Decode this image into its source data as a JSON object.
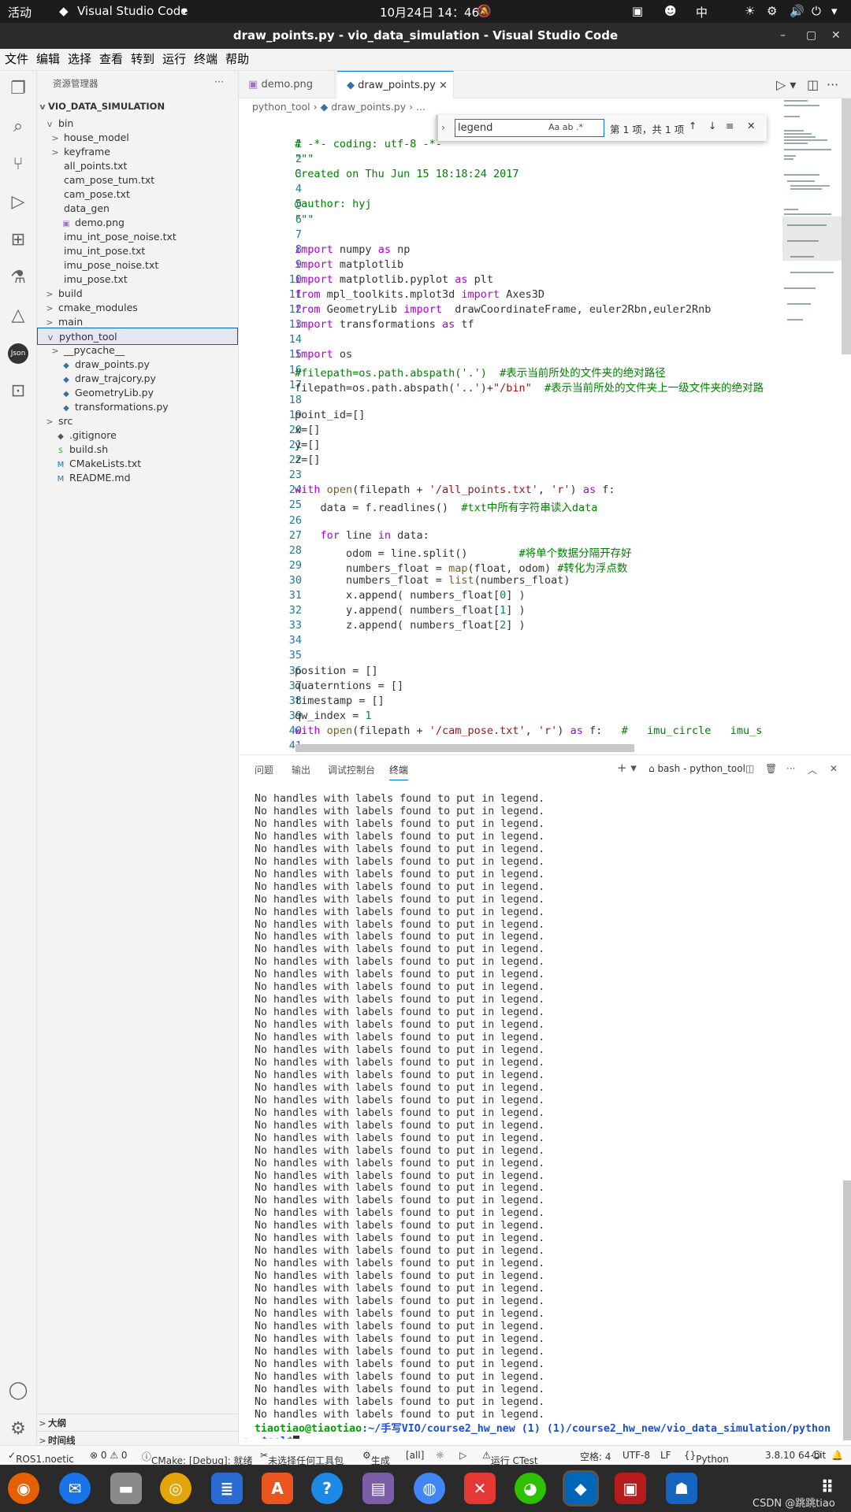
{
  "topbar": {
    "activities": "活动",
    "app": "Visual Studio Code",
    "datetime": "10月24日  14：46",
    "input": "中"
  },
  "window": {
    "title": "draw_points.py - vio_data_simulation - Visual Studio Code"
  },
  "menu": [
    "文件",
    "编辑",
    "选择",
    "查看",
    "转到",
    "运行",
    "终端",
    "帮助"
  ],
  "explorer": {
    "header": "资源管理器",
    "root": "VIO_DATA_SIMULATION",
    "items": [
      {
        "label": "bin",
        "depth": 1,
        "arrow": "v",
        "icon": ""
      },
      {
        "label": "house_model",
        "depth": 2,
        "arrow": ">",
        "icon": ""
      },
      {
        "label": "keyframe",
        "depth": 2,
        "arrow": ">",
        "icon": ""
      },
      {
        "label": "all_points.txt",
        "depth": 2,
        "arrow": "",
        "icon": ""
      },
      {
        "label": "cam_pose_tum.txt",
        "depth": 2,
        "arrow": "",
        "icon": ""
      },
      {
        "label": "cam_pose.txt",
        "depth": 2,
        "arrow": "",
        "icon": ""
      },
      {
        "label": "data_gen",
        "depth": 2,
        "arrow": "",
        "icon": ""
      },
      {
        "label": "demo.png",
        "depth": 2,
        "arrow": "",
        "icon": "img"
      },
      {
        "label": "imu_int_pose_noise.txt",
        "depth": 2,
        "arrow": "",
        "icon": ""
      },
      {
        "label": "imu_int_pose.txt",
        "depth": 2,
        "arrow": "",
        "icon": ""
      },
      {
        "label": "imu_pose_noise.txt",
        "depth": 2,
        "arrow": "",
        "icon": ""
      },
      {
        "label": "imu_pose.txt",
        "depth": 2,
        "arrow": "",
        "icon": ""
      },
      {
        "label": "build",
        "depth": 1,
        "arrow": ">",
        "icon": ""
      },
      {
        "label": "cmake_modules",
        "depth": 1,
        "arrow": ">",
        "icon": ""
      },
      {
        "label": "main",
        "depth": 1,
        "arrow": ">",
        "icon": ""
      },
      {
        "label": "python_tool",
        "depth": 1,
        "arrow": "v",
        "icon": ""
      },
      {
        "label": "__pycache__",
        "depth": 2,
        "arrow": ">",
        "icon": ""
      },
      {
        "label": "draw_points.py",
        "depth": 2,
        "arrow": "",
        "icon": "py"
      },
      {
        "label": "draw_trajcory.py",
        "depth": 2,
        "arrow": "",
        "icon": "py"
      },
      {
        "label": "GeometryLib.py",
        "depth": 2,
        "arrow": "",
        "icon": "py"
      },
      {
        "label": "transformations.py",
        "depth": 2,
        "arrow": "",
        "icon": "py"
      },
      {
        "label": "src",
        "depth": 1,
        "arrow": ">",
        "icon": ""
      },
      {
        "label": ".gitignore",
        "depth": 1,
        "arrow": "",
        "icon": "git"
      },
      {
        "label": "build.sh",
        "depth": 1,
        "arrow": "",
        "icon": "sh"
      },
      {
        "label": "CMakeLists.txt",
        "depth": 1,
        "arrow": "",
        "icon": "M"
      },
      {
        "label": "README.md",
        "depth": 1,
        "arrow": "",
        "icon": "md"
      }
    ],
    "outline": "大纲",
    "timeline": "时间线"
  },
  "tabs": [
    {
      "label": "demo.png"
    },
    {
      "label": "draw_points.py",
      "close": "×"
    }
  ],
  "breadcrumb": {
    "a": "python_tool",
    "b": "draw_points.py",
    "c": "..."
  },
  "find": {
    "query": "legend",
    "options": "Aa  ab  .*",
    "result": "第 1 项，共 1 项"
  },
  "code": [
    "# -*- coding: utf-8 -*-",
    "\"\"\"",
    "Created on Thu Jun 15 18:18:24 2017",
    "",
    "@author: hyj",
    "\"\"\"",
    "",
    "import numpy as np",
    "import matplotlib",
    "import matplotlib.pyplot as plt",
    "from mpl_toolkits.mplot3d import Axes3D",
    "from GeometryLib import  drawCoordinateFrame, euler2Rbn,euler2Rnb",
    "import transformations as tf",
    "",
    "import os",
    "#filepath=os.path.abspath('.')  #表示当前所处的文件夹的绝对路径",
    "filepath=os.path.abspath('..')+\"/bin\"  #表示当前所处的文件夹上一级文件夹的绝对路",
    "",
    "point_id=[]",
    "x=[]",
    "y=[]",
    "z=[]",
    "",
    "with open(filepath + '/all_points.txt', 'r') as f:",
    "    data = f.readlines()  #txt中所有字符串读入data",
    "",
    "    for line in data:",
    "        odom = line.split()        #将单个数据分隔开存好",
    "        numbers_float = map(float, odom) #转化为浮点数",
    "        numbers_float = list(numbers_float)",
    "        x.append( numbers_float[0] )",
    "        y.append( numbers_float[1] )",
    "        z.append( numbers_float[2] )",
    "",
    "",
    "position = []",
    "quaterntions = []",
    "timestamp = []",
    "qw_index = 1",
    "with open(filepath + '/cam_pose.txt', 'r') as f:   #   imu_circle   imu_s",
    ""
  ],
  "panel": {
    "tabs": [
      "问题",
      "输出",
      "调试控制台",
      "终端"
    ],
    "terminal_name": "bash - python_tool"
  },
  "terminal": {
    "line": "No handles with labels found to put in legend.",
    "repeat": 50,
    "prompt_user": "tiaotiao@tiaotiao",
    "prompt_path": ":~/手写VIO/course2_hw_new (1) (1)/course2_hw_new/vio_data_simulation/python",
    "prompt_path2": "_tool",
    "prompt_end": "$"
  },
  "status": {
    "ros": "ROS1.noetic",
    "errors": "⊗ 0  ⚠ 0",
    "cmake": "CMake: [Debug]: 就绪",
    "kit": "未选择任何工具包",
    "build": "生成",
    "all": "[all]",
    "ctest": "运行 CTest",
    "spaces": "空格: 4",
    "enc": "UTF-8",
    "eol": "LF",
    "lang": "Python",
    "ver": "3.8.10 64-bit"
  },
  "watermark": "CSDN @跳跳tiao"
}
